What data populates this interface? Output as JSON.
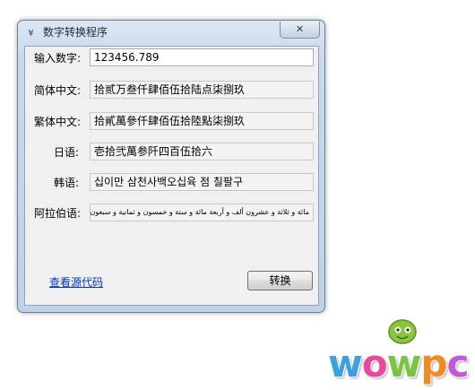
{
  "window": {
    "icon_glyph": "¥",
    "title": "数字转换程序",
    "close_glyph": "✕"
  },
  "input": {
    "label": "输入数字:",
    "value": "123456.789"
  },
  "outputs": {
    "simplified": {
      "label": "简体中文:",
      "value": "拾贰万叁仟肆佰伍拾陆点柒捌玖"
    },
    "traditional": {
      "label": "繁体中文:",
      "value": "拾貳萬參仟肆佰伍拾陸點柒捌玖"
    },
    "japanese": {
      "label": "日语:",
      "value": "壱拾弐萬参阡四百伍拾六"
    },
    "korean": {
      "label": "韩语:",
      "value": "십이만 삼천사백오십육 점 칠팔구"
    },
    "arabic": {
      "label": "阿拉伯语:",
      "value": "مائة و ثلاثة و عشرون ألف و أربعة مائة و ستة و خمسون و ثمانية و سبعون من مائة"
    }
  },
  "actions": {
    "view_source_label": "查看源代码",
    "convert_label": "转换"
  },
  "watermark": {
    "letters": [
      "w",
      "o",
      "w",
      "p",
      "c"
    ],
    "colors": [
      "#3aa0e0",
      "#e84a9a",
      "#7cc243",
      "#f08a24",
      "#c05ad8"
    ],
    "mascot_color": "#8cc63f"
  }
}
